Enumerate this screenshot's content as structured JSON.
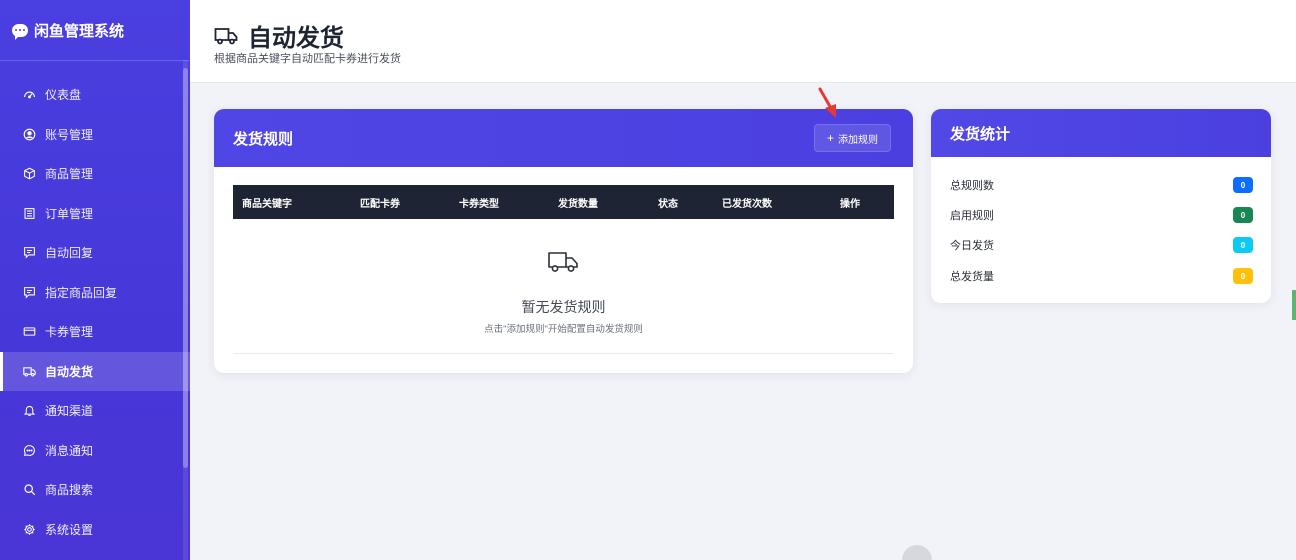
{
  "sidebar": {
    "brand": "闲鱼管理系统",
    "items": [
      {
        "label": "仪表盘",
        "icon": "gauge-icon"
      },
      {
        "label": "账号管理",
        "icon": "user-circle-icon"
      },
      {
        "label": "商品管理",
        "icon": "box-icon"
      },
      {
        "label": "订单管理",
        "icon": "receipt-icon"
      },
      {
        "label": "自动回复",
        "icon": "chat-square-icon"
      },
      {
        "label": "指定商品回复",
        "icon": "chat-square-icon"
      },
      {
        "label": "卡券管理",
        "icon": "card-icon"
      },
      {
        "label": "自动发货",
        "icon": "truck-icon",
        "active": true
      },
      {
        "label": "通知渠道",
        "icon": "bell-icon"
      },
      {
        "label": "消息通知",
        "icon": "chat-dots-icon"
      },
      {
        "label": "商品搜索",
        "icon": "search-icon"
      },
      {
        "label": "系统设置",
        "icon": "gear-icon"
      }
    ]
  },
  "header": {
    "title": "自动发货",
    "subtitle": "根据商品关键字自动匹配卡券进行发货",
    "icon": "truck-icon"
  },
  "rules": {
    "title": "发货规则",
    "add_button": "添加规则",
    "columns": [
      "商品关键字",
      "匹配卡券",
      "卡券类型",
      "发货数量",
      "状态",
      "已发货次数",
      "操作"
    ],
    "empty_title": "暂无发货规则",
    "empty_subtitle": "点击\"添加规则\"开始配置自动发货规则"
  },
  "stats": {
    "title": "发货统计",
    "rows": [
      {
        "label": "总规则数",
        "value": "0",
        "color": "#0d6efd"
      },
      {
        "label": "启用规则",
        "value": "0",
        "color": "#198754"
      },
      {
        "label": "今日发货",
        "value": "0",
        "color": "#0dcaf0"
      },
      {
        "label": "总发货量",
        "value": "0",
        "color": "#ffc107"
      }
    ]
  },
  "colors": {
    "sidebar": "#4a3fe0",
    "card_header": "#4f46e5",
    "table_header": "#1e2433",
    "annotation_arrow": "#e53935"
  }
}
